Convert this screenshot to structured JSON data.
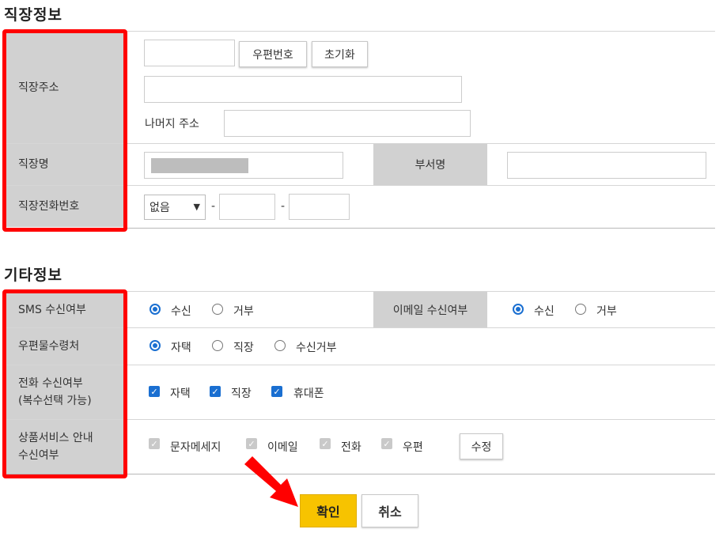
{
  "work": {
    "section_title": "직장정보",
    "address_label": "직장주소",
    "postcode_button": "우편번호",
    "reset_button": "초기화",
    "rest_address_label": "나머지 주소",
    "company_label": "직장명",
    "dept_label": "부서명",
    "phone_label": "직장전화번호",
    "phone_prefix": "없음",
    "dash": "-"
  },
  "etc": {
    "section_title": "기타정보",
    "sms_label": "SMS 수신여부",
    "sms_options": [
      "수신",
      "거부"
    ],
    "email_label": "이메일 수신여부",
    "email_options": [
      "수신",
      "거부"
    ],
    "mail_label": "우편물수령처",
    "mail_options": [
      "자택",
      "직장",
      "수신거부"
    ],
    "phone_recv_label_1": "전화 수신여부",
    "phone_recv_label_2": "(복수선택 가능)",
    "phone_recv_options": [
      "자택",
      "직장",
      "휴대폰"
    ],
    "service_label_1": "상품서비스 안내",
    "service_label_2": "수신여부",
    "service_options": [
      "문자메세지",
      "이메일",
      "전화",
      "우편"
    ],
    "edit_button": "수정"
  },
  "actions": {
    "confirm": "확인",
    "cancel": "취소"
  },
  "colors": {
    "highlight": "#ff0000",
    "confirm": "#f7c300",
    "accent": "#1a6fd1"
  }
}
